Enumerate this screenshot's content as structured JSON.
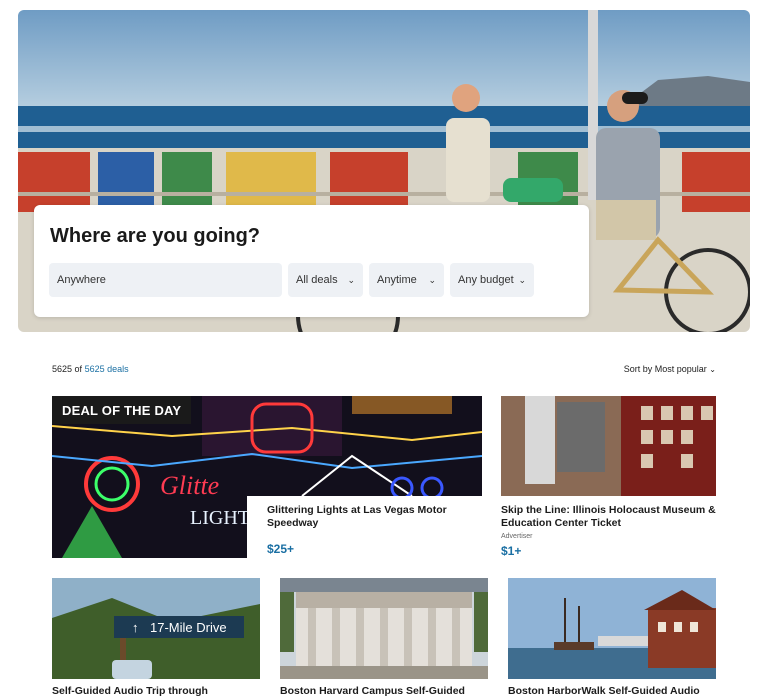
{
  "search": {
    "title": "Where are you going?",
    "where_value": "Anywhere",
    "deals_label": "All deals",
    "time_label": "Anytime",
    "budget_label": "Any budget"
  },
  "results": {
    "count": "5625",
    "of": "of",
    "total_link": "5625 deals",
    "sort_label": "Sort by Most popular"
  },
  "deal_of_day": {
    "badge": "DEAL OF THE DAY",
    "title": "Glittering Lights at Las Vegas Motor Speedway",
    "price": "$25+",
    "image_sign_text": "Gl...Lights"
  },
  "side_card": {
    "title": "Skip the Line: Illinois Holocaust Museum & Education Center Ticket",
    "advertiser": "Advertiser",
    "price": "$1+"
  },
  "cards": [
    {
      "title": "Self-Guided Audio Trip through",
      "sign": "17-Mile Drive"
    },
    {
      "title": "Boston Harvard Campus Self-Guided"
    },
    {
      "title": "Boston HarborWalk Self-Guided Audio"
    }
  ],
  "colors": {
    "accent": "#1a6fa3",
    "badge_bg": "#1a1a1a",
    "field_bg": "#eef1f5"
  }
}
